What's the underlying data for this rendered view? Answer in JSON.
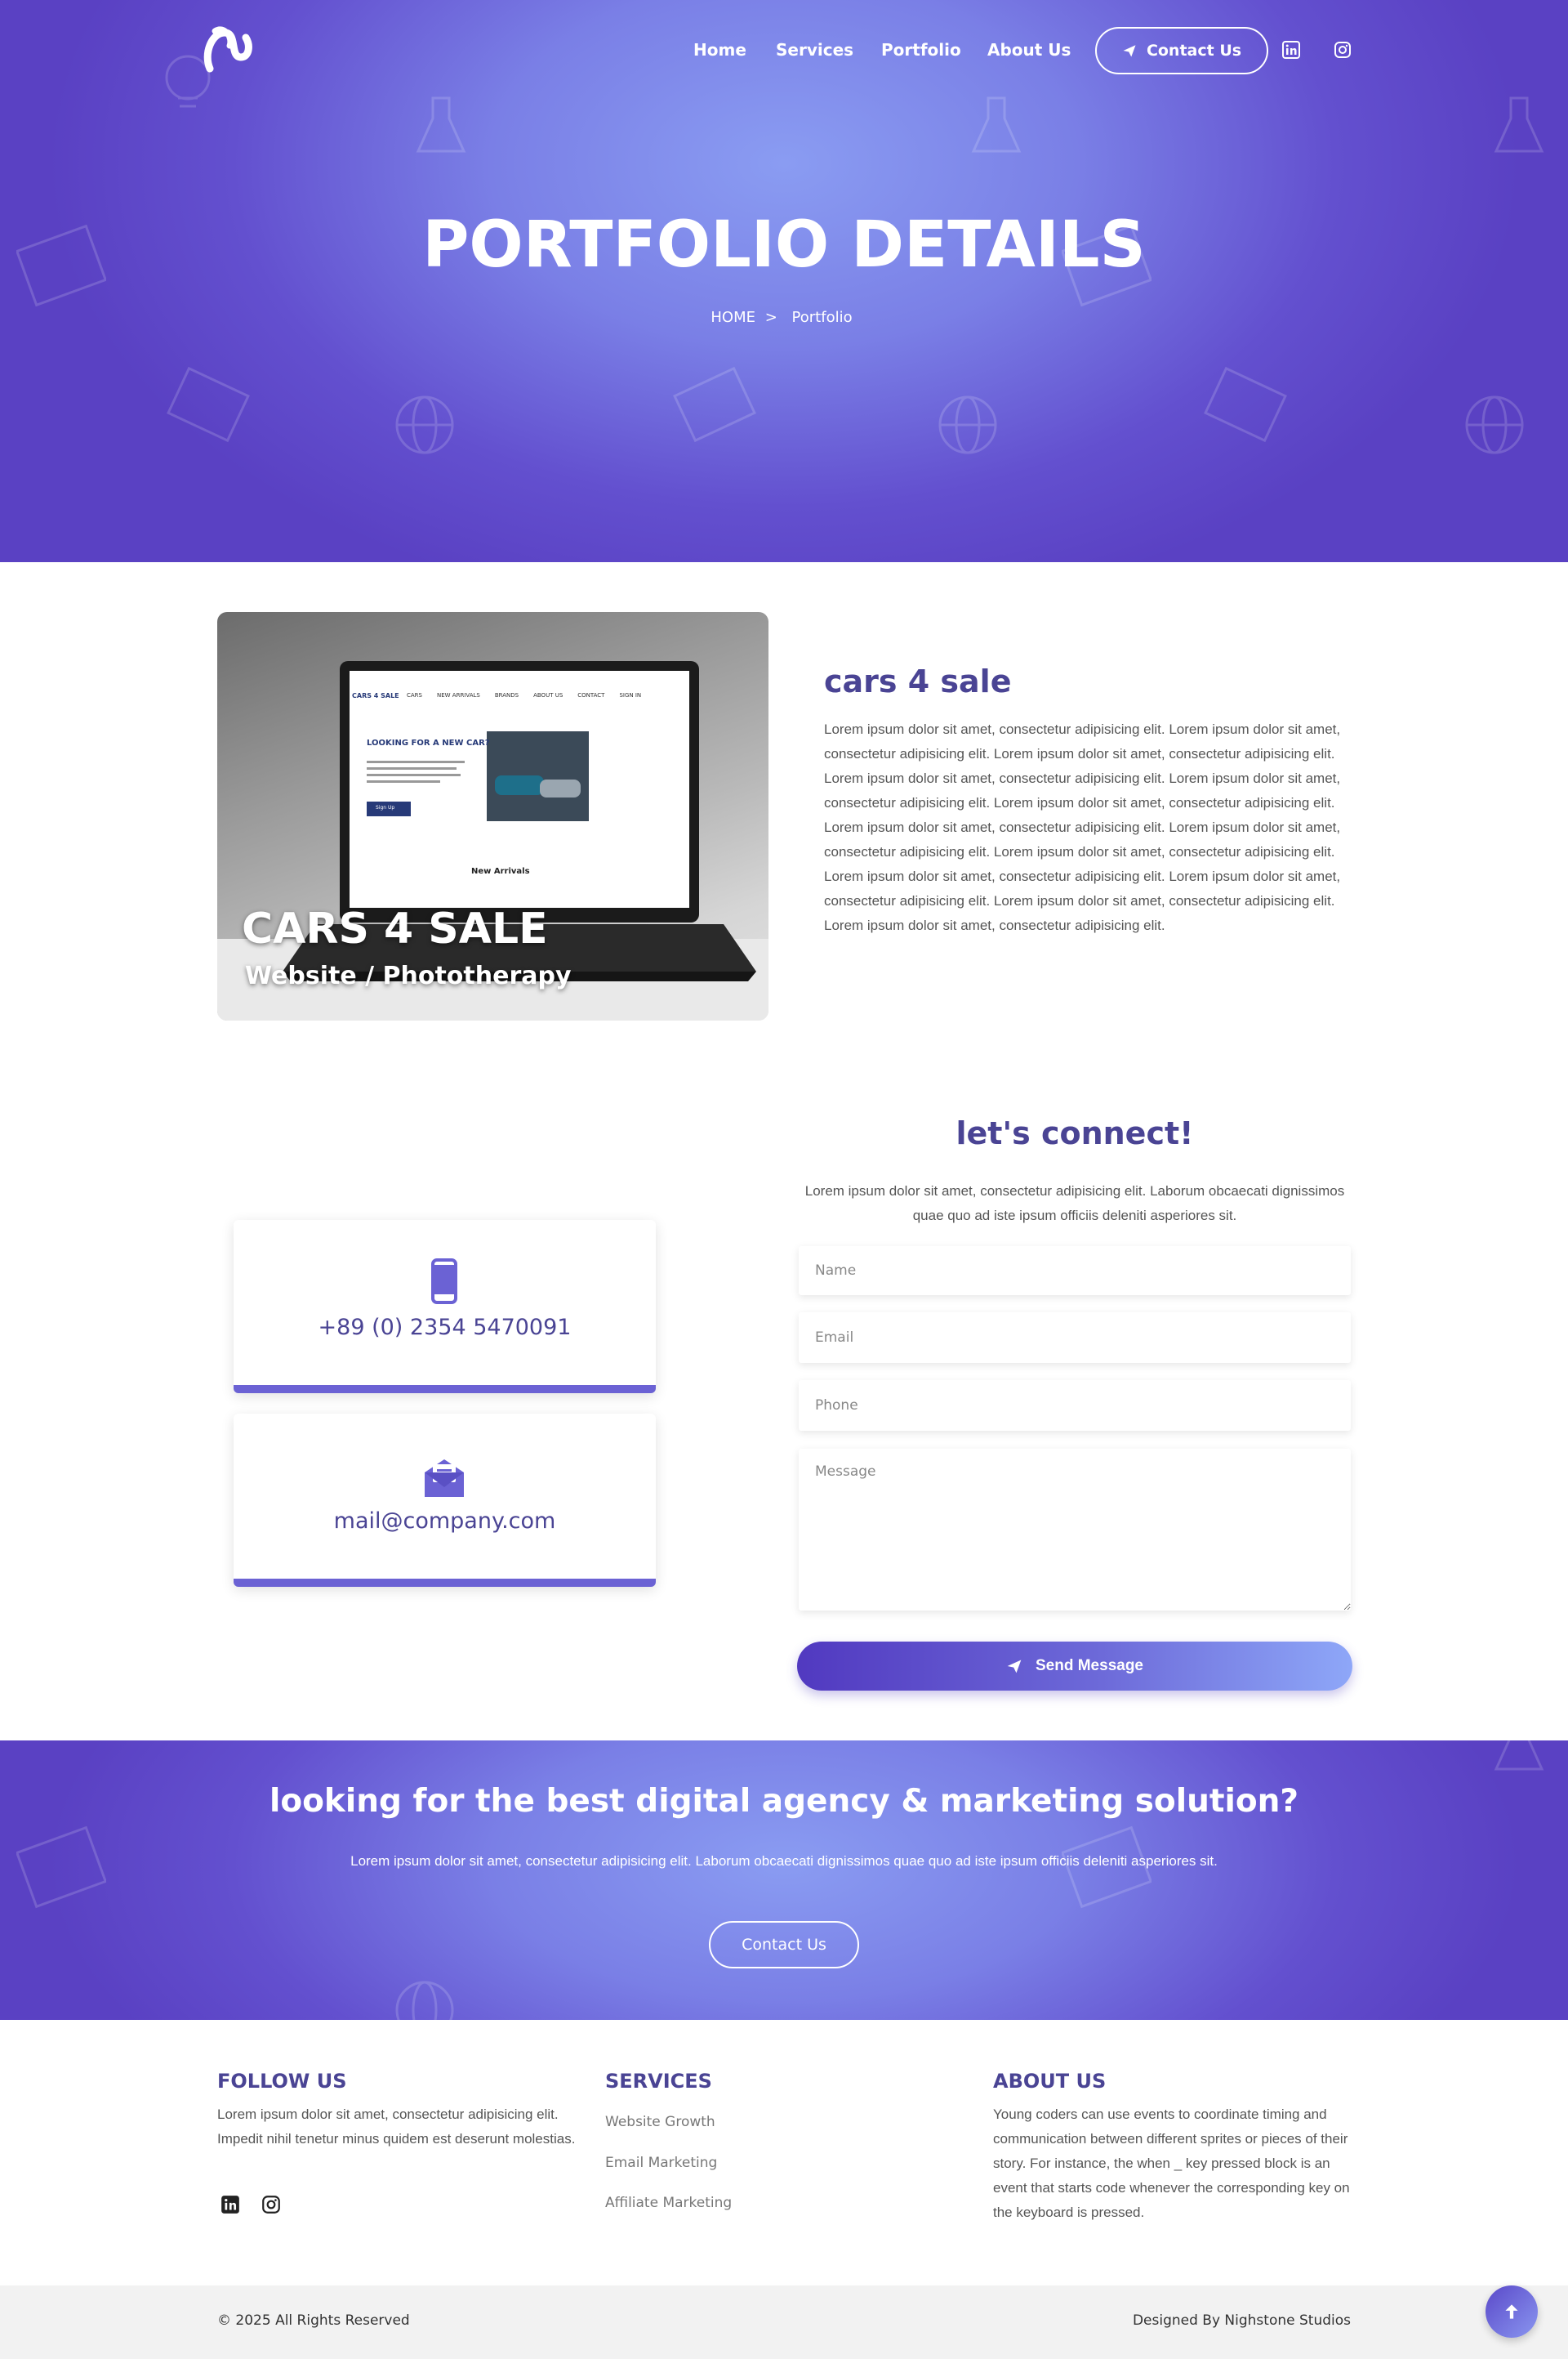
{
  "nav": {
    "items": [
      "Home",
      "Services",
      "Portfolio",
      "About Us"
    ],
    "contact_label": "Contact Us"
  },
  "hero": {
    "title": "PORTFOLIO DETAILS",
    "breadcrumb_home": "HOME",
    "breadcrumb_sep": ">",
    "breadcrumb_current": "Portfolio"
  },
  "project": {
    "image_caption_title": "CARS 4 SALE",
    "image_caption_sub": "Website / Phototherapy",
    "title": "cars 4 sale",
    "description": "Lorem ipsum dolor sit amet, consectetur adipisicing elit. Lorem ipsum dolor sit amet, consectetur adipisicing elit. Lorem ipsum dolor sit amet, consectetur adipisicing elit. Lorem ipsum dolor sit amet, consectetur adipisicing elit. Lorem ipsum dolor sit amet, consectetur adipisicing elit. Lorem ipsum dolor sit amet, consectetur adipisicing elit. Lorem ipsum dolor sit amet, consectetur adipisicing elit. Lorem ipsum dolor sit amet, consectetur adipisicing elit. Lorem ipsum dolor sit amet, consectetur adipisicing elit. Lorem ipsum dolor sit amet, consectetur adipisicing elit. Lorem ipsum dolor sit amet, consectetur adipisicing elit. Lorem ipsum dolor sit amet, consectetur adipisicing elit. Lorem ipsum dolor sit amet, consectetur adipisicing elit.",
    "laptop_screen": {
      "brand": "CARS 4 SALE",
      "menu": [
        "CARS",
        "NEW ARRIVALS",
        "BRANDS",
        "ABOUT US",
        "CONTACT",
        "SIGN IN"
      ],
      "headline": "LOOKING FOR A NEW CAR?",
      "button": "Sign Up",
      "section": "New Arrivals"
    }
  },
  "connect": {
    "title": "let's connect!",
    "description": "Lorem ipsum dolor sit amet, consectetur adipisicing elit. Laborum obcaecati dignissimos quae quo ad iste ipsum officiis deleniti asperiores sit.",
    "phone": "+89 (0) 2354 5470091",
    "email": "mail@company.com",
    "form": {
      "name_placeholder": "Name",
      "email_placeholder": "Email",
      "phone_placeholder": "Phone",
      "message_placeholder": "Message",
      "send_label": "Send Message"
    }
  },
  "cta": {
    "title": "looking for the best digital agency & marketing solution?",
    "description": "Lorem ipsum dolor sit amet, consectetur adipisicing elit. Laborum obcaecati dignissimos quae quo ad iste ipsum officiis deleniti asperiores sit.",
    "button": "Contact Us"
  },
  "footer": {
    "follow": {
      "heading": "FOLLOW US",
      "text": "Lorem ipsum dolor sit amet, consectetur adipisicing elit. Impedit nihil tenetur minus quidem est deserunt molestias."
    },
    "services": {
      "heading": "SERVICES",
      "links": [
        "Website Growth",
        "Email Marketing",
        "Affiliate Marketing"
      ]
    },
    "about": {
      "heading": "ABOUT US",
      "text": "Young coders can use events to coordinate timing and communication between different sprites or pieces of their story. For instance, the when _ key pressed block is an event that starts code whenever the corresponding key on the keyboard is pressed."
    },
    "copyright": "© 2025 All Rights Reserved",
    "designed_by": "Designed By Nighstone Studios"
  },
  "colors": {
    "accent": "#4a4494",
    "gradient_start": "#5a41c3",
    "gradient_end": "#8a9cf2",
    "card_border": "#6b62d4"
  },
  "icons": {
    "logo": "brand-logo",
    "contact": "paper-plane-icon",
    "social": [
      "linkedin-icon",
      "instagram-icon"
    ],
    "phone": "mobile-phone-icon",
    "email": "envelope-open-icon",
    "scroll": "arrow-up-icon"
  }
}
